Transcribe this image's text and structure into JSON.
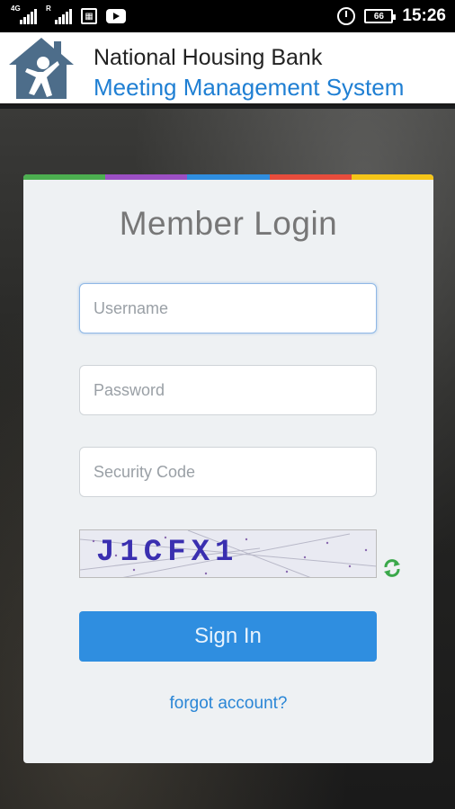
{
  "status_bar": {
    "network": "4G",
    "roaming": "R",
    "battery": "66",
    "time": "15:26",
    "icons": [
      "signal-icon",
      "signal-roaming-icon",
      "app-notification-icon",
      "youtube-icon",
      "alarm-icon",
      "battery-icon"
    ]
  },
  "header": {
    "org_name": "National Housing Bank",
    "system_name": "Meeting Management System",
    "logo_icon": "house-person-logo-icon"
  },
  "login": {
    "title": "Member Login",
    "username_placeholder": "Username",
    "username_value": "",
    "password_placeholder": "Password",
    "password_value": "",
    "security_code_placeholder": "Security Code",
    "security_code_value": "",
    "captcha_text": "J1CFX1",
    "refresh_icon": "refresh-captcha-icon",
    "sign_in_label": "Sign In",
    "forgot_label": "forgot account?"
  },
  "colors": {
    "stripe": [
      "#4caf50",
      "#9c4fc4",
      "#2f8ee0",
      "#e74c3c",
      "#f5c518"
    ],
    "accent": "#2f8ee0",
    "brand_blue": "#1f7fd3",
    "card_bg": "#eef1f3"
  }
}
